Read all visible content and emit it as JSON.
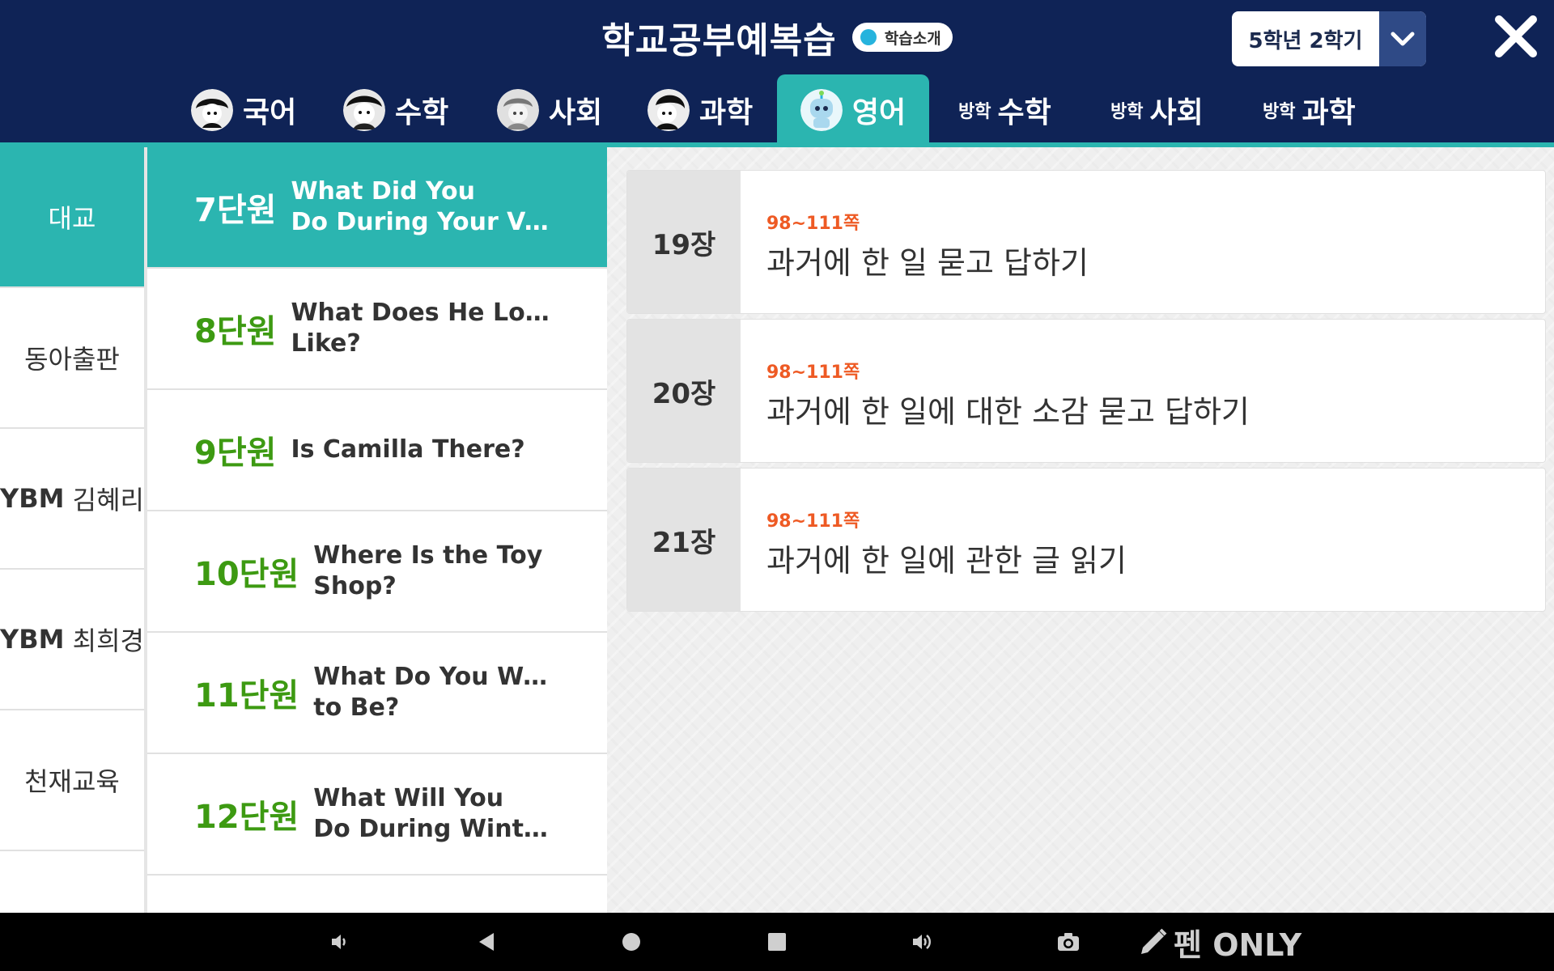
{
  "header": {
    "title": "학교공부예복습",
    "intro_badge": "학습소개",
    "semester": "5학년 2학기"
  },
  "tabs": [
    {
      "prefix": "",
      "label": "국어",
      "avatar": "korean-character-avatar",
      "active": false
    },
    {
      "prefix": "",
      "label": "수학",
      "avatar": "math-character-avatar",
      "active": false
    },
    {
      "prefix": "",
      "label": "사회",
      "avatar": "social-character-avatar",
      "active": false
    },
    {
      "prefix": "",
      "label": "과학",
      "avatar": "science-character-avatar",
      "active": false
    },
    {
      "prefix": "",
      "label": "영어",
      "avatar": "robot-character-avatar",
      "active": true
    },
    {
      "prefix": "방학",
      "label": "수학",
      "active": false
    },
    {
      "prefix": "방학",
      "label": "사회",
      "active": false
    },
    {
      "prefix": "방학",
      "label": "과학",
      "active": false
    }
  ],
  "publishers": [
    {
      "label": "대교",
      "active": true
    },
    {
      "label": "동아출판",
      "active": false
    },
    {
      "prefix": "YBM",
      "label": " 김혜리",
      "active": false
    },
    {
      "prefix": "YBM",
      "label": " 최희경",
      "active": false
    },
    {
      "label": "천재교육",
      "active": false
    }
  ],
  "units": [
    {
      "num": "7단원",
      "line1": "What Did You",
      "line2": "Do During Your Vac...",
      "active": true
    },
    {
      "num": "8단원",
      "line1": "What Does He Look",
      "line2": "Like?",
      "active": false
    },
    {
      "num": "9단원",
      "line1": "Is Camilla There?",
      "line2": "",
      "active": false
    },
    {
      "num": "10단원",
      "line1": "Where Is the Toy",
      "line2": "Shop?",
      "active": false
    },
    {
      "num": "11단원",
      "line1": "What Do You Want",
      "line2": "to Be?",
      "active": false
    },
    {
      "num": "12단원",
      "line1": "What Will You",
      "line2": "Do During Winter ...",
      "active": false
    }
  ],
  "chapters": [
    {
      "num": "19장",
      "pages": "98~111쪽",
      "title": "과거에 한 일 묻고 답하기"
    },
    {
      "num": "20장",
      "pages": "98~111쪽",
      "title": "과거에 한 일에 대한 소감 묻고 답하기"
    },
    {
      "num": "21장",
      "pages": "98~111쪽",
      "title": "과거에 한 일에 관한 글 읽기"
    }
  ],
  "navbar": {
    "pen_only": "펜 ONLY"
  },
  "colors": {
    "header_bg": "#0f2356",
    "accent_teal": "#2bb5b0",
    "unit_number_green": "#3d9a12",
    "page_range_orange": "#ee5a24"
  }
}
